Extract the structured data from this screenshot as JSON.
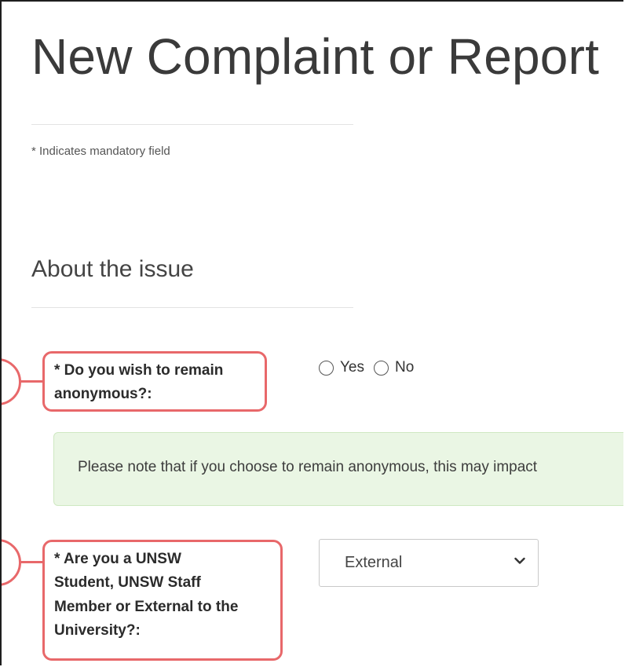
{
  "page": {
    "title": "New Complaint or Report",
    "mandatory_note": "* Indicates mandatory field"
  },
  "section": {
    "title": "About the issue"
  },
  "questions": [
    {
      "label_line1": "* Do you wish to remain",
      "label_line2": "anonymous?:",
      "options": [
        "Yes",
        "No"
      ]
    },
    {
      "label_line1": "* Are you a UNSW",
      "label_line2": "Student, UNSW Staff",
      "label_line3": "Member or External to the",
      "label_line4": "University?:",
      "selected": "External"
    }
  ],
  "notice": {
    "text": "Please note that if you choose to remain anonymous, this may impact"
  },
  "colors": {
    "callout_border": "#e8686a",
    "notice_bg": "#eaf6e4",
    "title_text": "#3a3a3a"
  },
  "icons": {
    "select_arrow": "chevron-down-icon"
  }
}
